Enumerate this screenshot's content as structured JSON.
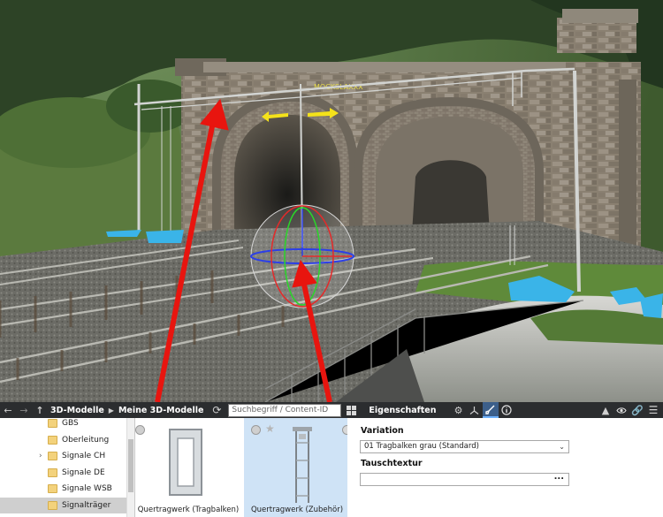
{
  "toolbar": {
    "crumb1": "3D-Modelle",
    "crumb2": "Meine 3D-Modelle",
    "search_placeholder": "Suchbegriff / Content-ID",
    "properties_title": "Eigenschaften"
  },
  "tree": {
    "items": [
      {
        "label": "GBS",
        "expandable": false
      },
      {
        "label": "Oberleitung",
        "expandable": false
      },
      {
        "label": "Signale CH",
        "expandable": true
      },
      {
        "label": "Signale DE",
        "expandable": false
      },
      {
        "label": "Signale WSB",
        "expandable": false
      },
      {
        "label": "Signalträger",
        "expandable": false,
        "selected": true
      }
    ]
  },
  "models": {
    "items": [
      {
        "name": "Quertragwerk (Tragbalken)"
      },
      {
        "name": "Quertragwerk (Zubehör)"
      }
    ]
  },
  "properties": {
    "variation_label": "Variation",
    "variation_value": "01 Tragbalken grau (Standard)",
    "texture_label": "Tauschtextur",
    "texture_button": "..."
  },
  "scene": {
    "portal_sign": "MOCKSLAXXX"
  },
  "colors": {
    "toolbar_bg": "#2b2d2f",
    "selected_card": "#cfe3f6",
    "annotation_arrow": "#e8150f",
    "direction_arrow": "#f4e21a",
    "marker_blue": "#3ab4e8"
  }
}
